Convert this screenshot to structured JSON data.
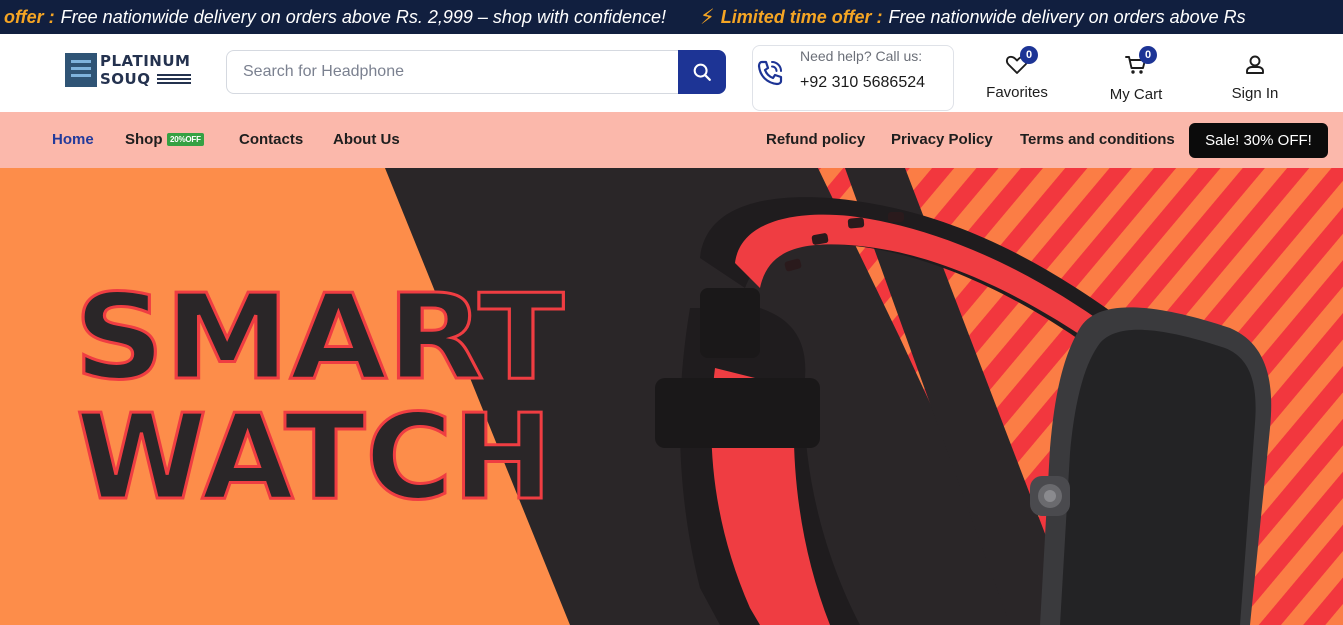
{
  "ticker": {
    "offer_lead": "offer :",
    "message": "Free nationwide delivery  on orders above Rs. 2,999 – shop with confidence!",
    "offer_label": "Limited time offer :",
    "message_repeat": "Free nationwide delivery  on orders above Rs"
  },
  "logo": {
    "line1": "PLATINUM",
    "line2": "SOUQ"
  },
  "search": {
    "placeholder": "Search for Headphone",
    "value": ""
  },
  "help": {
    "label": "Need help? Call us:",
    "phone": "+92 310 5686524"
  },
  "header": {
    "favorites": {
      "label": "Favorites",
      "count": "0"
    },
    "cart": {
      "label": "My Cart",
      "count": "0"
    },
    "signin": {
      "label": "Sign In"
    }
  },
  "nav": {
    "left": [
      "Home",
      "Shop",
      "Contacts",
      "About Us"
    ],
    "shop_tag": "20%OFF",
    "right": [
      "Refund policy",
      "Privacy Policy",
      "Terms and conditions"
    ],
    "sale_button": "Sale! 30% OFF!"
  },
  "hero": {
    "line1": "SMART",
    "line2": "WATCH"
  },
  "colors": {
    "ticker_bg": "#111f3f",
    "accent_orange": "#f5a524",
    "brand_blue": "#1d3495",
    "nav_bg": "#fbb8ab",
    "hero_orange": "#fd8d4a",
    "hero_dark": "#2a2628",
    "hero_red": "#f2373e"
  }
}
